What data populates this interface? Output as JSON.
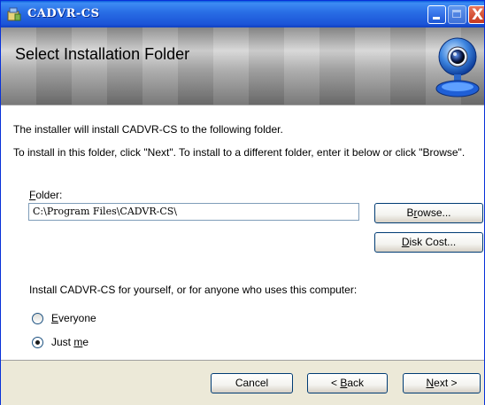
{
  "window": {
    "title": "CADVR-CS",
    "minimize_icon": "minimize-icon",
    "maximize_icon": "maximize-icon",
    "close_icon": "close-icon",
    "close_glyph": "X"
  },
  "banner": {
    "title": "Select Installation Folder",
    "logo_icon": "webcam-icon"
  },
  "body": {
    "intro": "The installer will install CADVR-CS to the following folder.",
    "instructions": "To install in this folder, click \"Next\". To install to a different folder, enter it below or click \"Browse\".",
    "folder_label_mnemonic": "F",
    "folder_label_rest": "older:",
    "folder_value": "C:\\Program Files\\CADVR-CS\\",
    "browse_pre": "B",
    "browse_mnemonic": "r",
    "browse_rest": "owse...",
    "diskcost_mnemonic": "D",
    "diskcost_rest": "isk Cost...",
    "install_for": "Install CADVR-CS for yourself, or for anyone who uses this computer:",
    "options": [
      {
        "mnemonic": "E",
        "rest": "veryone",
        "selected": false
      },
      {
        "pre": "Just ",
        "mnemonic": "m",
        "rest": "e",
        "selected": true
      }
    ]
  },
  "footer": {
    "cancel": "Cancel",
    "back_pre": "< ",
    "back_mnemonic": "B",
    "back_rest": "ack",
    "next_mnemonic": "N",
    "next_rest": "ext >"
  }
}
